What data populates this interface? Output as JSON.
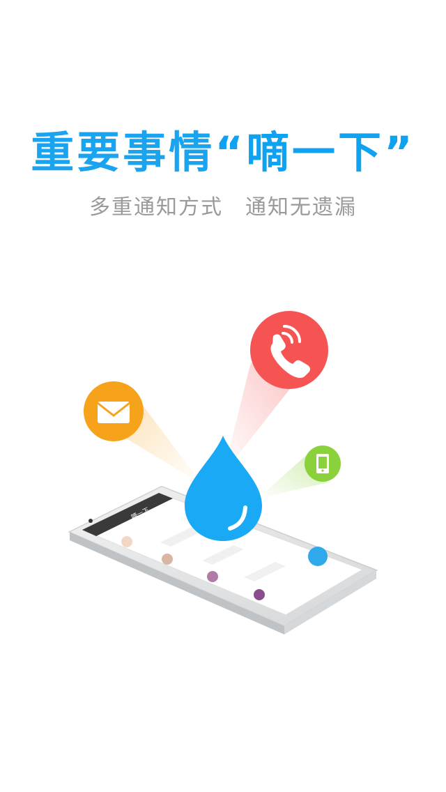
{
  "headline": {
    "main": "重要事情",
    "quoted": "“嘀一下”"
  },
  "subline": {
    "left": "多重通知方式",
    "right": "通知无遗漏"
  },
  "icons": {
    "mail": {
      "name": "mail-icon",
      "color": "#f7a21b"
    },
    "phone": {
      "name": "phone-call-icon",
      "color": "#f65353"
    },
    "mobile": {
      "name": "mobile-icon",
      "color": "#8ad13b"
    },
    "drop": {
      "name": "water-drop-logo",
      "color": "#1aa9f5"
    }
  },
  "phone_screen": {
    "title": "嘀一下"
  }
}
